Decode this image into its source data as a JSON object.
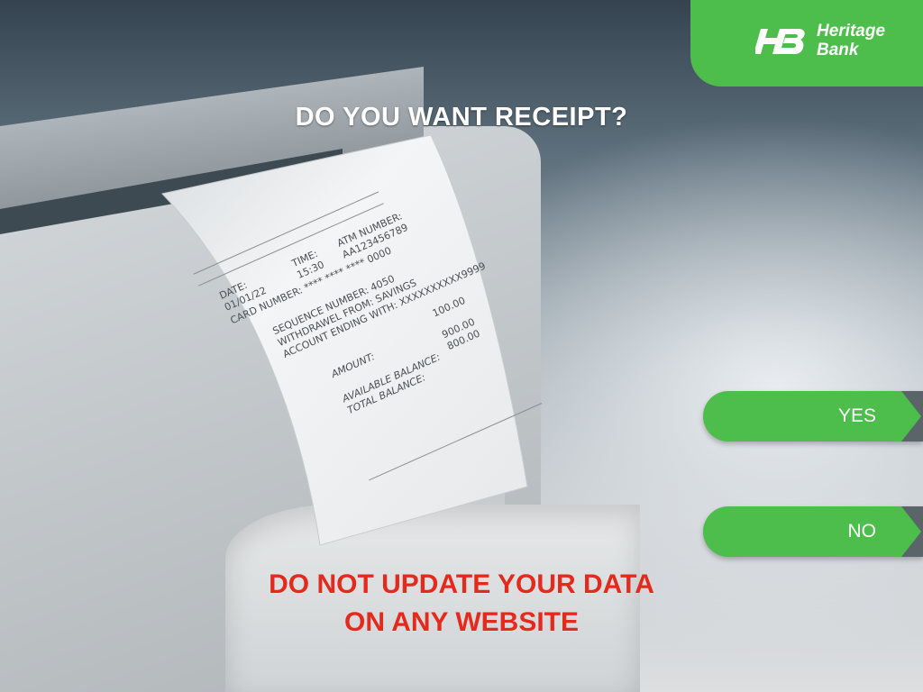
{
  "bank": {
    "name_line1": "Heritage",
    "name_line2": "Bank",
    "logo_initials": "HB"
  },
  "prompt": "DO YOU WANT RECEIPT?",
  "options": {
    "yes_label": "YES",
    "no_label": "NO"
  },
  "warning": {
    "line1": "DO NOT UPDATE YOUR DATA",
    "line2": "ON ANY WEBSITE"
  },
  "receipt": {
    "date_label": "DATE:",
    "date_value": "01/01/22",
    "time_label": "TIME:",
    "time_value": "15:30",
    "atm_label": "ATM NUMBER:",
    "atm_value": "AA123456789",
    "card_line": "CARD NUMBER: **** **** **** 0000",
    "sequence_line": "SEQUENCE NUMBER: 4050",
    "withdrawal_line": "WITHDRAWEL FROM: SAVINGS",
    "account_line": "ACCOUNT ENDING WITH: XXXXXXXXXX9999",
    "amount_label": "AMOUNT:",
    "amount_value": "100.00",
    "available_label": "AVAILABLE BALANCE:",
    "available_value": "900.00",
    "total_label": "TOTAL BALANCE:",
    "total_value": "800.00"
  },
  "colors": {
    "brand_green": "#4dbd4b",
    "warning_red": "#e42a1d",
    "tip_gray": "#5b6469"
  }
}
